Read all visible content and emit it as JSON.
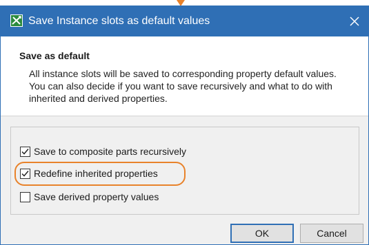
{
  "window": {
    "title": "Save Instance slots as default values",
    "app_icon": "magicdraw-app-icon",
    "close_icon": "close-icon",
    "accent_color": "#2f6fb5"
  },
  "header": {
    "title": "Save as default",
    "description": "All instance slots will be saved to corresponding property default values.  You can also decide if you want to save recursively and what to do with inherited and derived properties."
  },
  "options": [
    {
      "label": "Save to composite parts recursively",
      "checked": true
    },
    {
      "label": "Redefine inherited properties",
      "checked": true,
      "highlighted": true
    },
    {
      "label": "Save derived property values",
      "checked": false
    }
  ],
  "highlight_color": "#e8822a",
  "buttons": {
    "ok": "OK",
    "cancel": "Cancel"
  }
}
